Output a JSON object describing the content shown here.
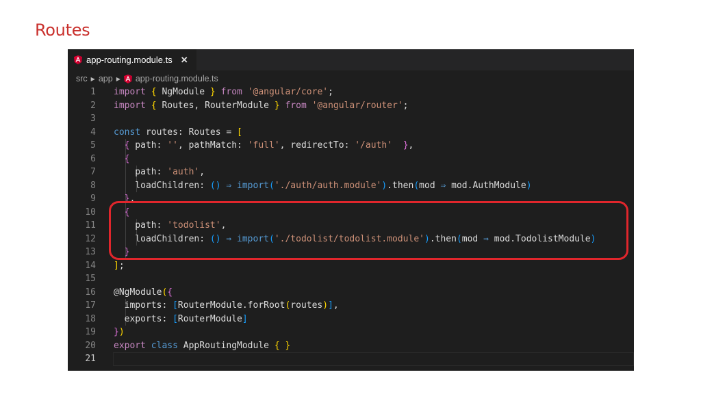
{
  "slide": {
    "title": "Routes"
  },
  "editor": {
    "tab": {
      "label": "app-routing.module.ts",
      "close": "✕"
    },
    "breadcrumb": [
      "src",
      "app",
      "app-routing.module.ts"
    ],
    "active_line": 21
  },
  "code_lines": [
    {
      "n": 1,
      "segs": [
        [
          "kc",
          "import"
        ],
        [
          "t",
          " "
        ],
        [
          "b1",
          "{"
        ],
        [
          "t",
          " NgModule "
        ],
        [
          "b1",
          "}"
        ],
        [
          "t",
          " "
        ],
        [
          "kc",
          "from"
        ],
        [
          "t",
          " "
        ],
        [
          "s",
          "'@angular/core'"
        ],
        [
          "t",
          ";"
        ]
      ]
    },
    {
      "n": 2,
      "segs": [
        [
          "kc",
          "import"
        ],
        [
          "t",
          " "
        ],
        [
          "b1",
          "{"
        ],
        [
          "t",
          " Routes, RouterModule "
        ],
        [
          "b1",
          "}"
        ],
        [
          "t",
          " "
        ],
        [
          "kc",
          "from"
        ],
        [
          "t",
          " "
        ],
        [
          "s",
          "'@angular/router'"
        ],
        [
          "t",
          ";"
        ]
      ]
    },
    {
      "n": 3,
      "segs": []
    },
    {
      "n": 4,
      "segs": [
        [
          "k",
          "const"
        ],
        [
          "t",
          " routes: Routes = "
        ],
        [
          "b1",
          "["
        ]
      ]
    },
    {
      "n": 5,
      "segs": [
        [
          "t",
          "  "
        ],
        [
          "b2",
          "{"
        ],
        [
          "t",
          " path: "
        ],
        [
          "s",
          "''"
        ],
        [
          "t",
          ", pathMatch: "
        ],
        [
          "s",
          "'full'"
        ],
        [
          "t",
          ", redirectTo: "
        ],
        [
          "s",
          "'/auth'"
        ],
        [
          "t",
          "  "
        ],
        [
          "b2",
          "}"
        ],
        [
          "t",
          ","
        ]
      ]
    },
    {
      "n": 6,
      "segs": [
        [
          "t",
          "  "
        ],
        [
          "b2",
          "{"
        ]
      ]
    },
    {
      "n": 7,
      "segs": [
        [
          "t",
          "    path: "
        ],
        [
          "s",
          "'auth'"
        ],
        [
          "t",
          ","
        ]
      ]
    },
    {
      "n": 8,
      "segs": [
        [
          "t",
          "    loadChildren: "
        ],
        [
          "b3",
          "()"
        ],
        [
          "t",
          " "
        ],
        [
          "k",
          "⇒"
        ],
        [
          "t",
          " "
        ],
        [
          "k",
          "import"
        ],
        [
          "b3",
          "("
        ],
        [
          "s",
          "'./auth/auth.module'"
        ],
        [
          "b3",
          ")"
        ],
        [
          "t",
          ".then"
        ],
        [
          "b3",
          "("
        ],
        [
          "t",
          "mod "
        ],
        [
          "k",
          "⇒"
        ],
        [
          "t",
          " mod.AuthModule"
        ],
        [
          "b3",
          ")"
        ]
      ]
    },
    {
      "n": 9,
      "segs": [
        [
          "t",
          "  "
        ],
        [
          "b2",
          "}"
        ],
        [
          "t",
          ","
        ]
      ]
    },
    {
      "n": 10,
      "segs": [
        [
          "t",
          "  "
        ],
        [
          "b2",
          "{"
        ]
      ]
    },
    {
      "n": 11,
      "segs": [
        [
          "t",
          "    path: "
        ],
        [
          "s",
          "'todolist'"
        ],
        [
          "t",
          ","
        ]
      ]
    },
    {
      "n": 12,
      "segs": [
        [
          "t",
          "    loadChildren: "
        ],
        [
          "b3",
          "()"
        ],
        [
          "t",
          " "
        ],
        [
          "k",
          "⇒"
        ],
        [
          "t",
          " "
        ],
        [
          "k",
          "import"
        ],
        [
          "b3",
          "("
        ],
        [
          "s",
          "'./todolist/todolist.module'"
        ],
        [
          "b3",
          ")"
        ],
        [
          "t",
          ".then"
        ],
        [
          "b3",
          "("
        ],
        [
          "t",
          "mod "
        ],
        [
          "k",
          "⇒"
        ],
        [
          "t",
          " mod.TodolistModule"
        ],
        [
          "b3",
          ")"
        ]
      ]
    },
    {
      "n": 13,
      "segs": [
        [
          "t",
          "  "
        ],
        [
          "b2",
          "}"
        ]
      ]
    },
    {
      "n": 14,
      "segs": [
        [
          "b1",
          "]"
        ],
        [
          "t",
          ";"
        ]
      ]
    },
    {
      "n": 15,
      "segs": []
    },
    {
      "n": 16,
      "segs": [
        [
          "t",
          "@NgModule"
        ],
        [
          "b1",
          "("
        ],
        [
          "b2",
          "{"
        ]
      ]
    },
    {
      "n": 17,
      "segs": [
        [
          "t",
          "  imports: "
        ],
        [
          "b3",
          "["
        ],
        [
          "t",
          "RouterModule.forRoot"
        ],
        [
          "b1",
          "("
        ],
        [
          "t",
          "routes"
        ],
        [
          "b1",
          ")"
        ],
        [
          "b3",
          "]"
        ],
        [
          "t",
          ","
        ]
      ]
    },
    {
      "n": 18,
      "segs": [
        [
          "t",
          "  exports: "
        ],
        [
          "b3",
          "["
        ],
        [
          "t",
          "RouterModule"
        ],
        [
          "b3",
          "]"
        ]
      ]
    },
    {
      "n": 19,
      "segs": [
        [
          "b2",
          "}"
        ],
        [
          "b1",
          ")"
        ]
      ]
    },
    {
      "n": 20,
      "segs": [
        [
          "kc",
          "export"
        ],
        [
          "t",
          " "
        ],
        [
          "k",
          "class"
        ],
        [
          "t",
          " AppRoutingModule "
        ],
        [
          "b1",
          "{"
        ],
        [
          "t",
          " "
        ],
        [
          "b1",
          "}"
        ]
      ]
    },
    {
      "n": 21,
      "segs": []
    }
  ]
}
